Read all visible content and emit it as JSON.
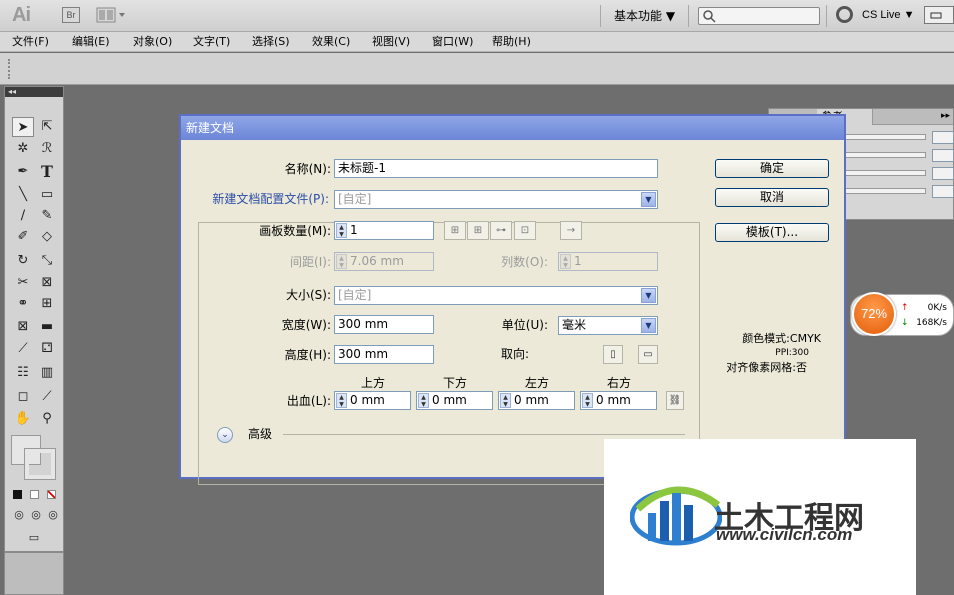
{
  "appbar": {
    "logo": "Ai",
    "br_label": "Br",
    "workspace": "基本功能 ▼",
    "cs_live": "CS Live ▼",
    "search_placeholder": ""
  },
  "menu": [
    "文件(F)",
    "编辑(E)",
    "对象(O)",
    "文字(T)",
    "选择(S)",
    "效果(C)",
    "视图(V)",
    "窗口(W)",
    "帮助(H)"
  ],
  "tools_header": "◂◂",
  "right_panel": {
    "tab": "参考"
  },
  "dialog": {
    "title": "新建文档",
    "name_label": "名称(N):",
    "name_value": "未标题-1",
    "profile_label": "新建文档配置文件(P):",
    "profile_value": "[自定]",
    "artboards_label": "画板数量(M):",
    "artboards_value": "1",
    "spacing_label": "间距(I):",
    "spacing_value": "7.06 mm",
    "columns_label": "列数(O):",
    "columns_value": "1",
    "size_label": "大小(S):",
    "size_value": "[自定]",
    "width_label": "宽度(W):",
    "width_value": "300 mm",
    "units_label": "单位(U):",
    "units_value": "毫米",
    "height_label": "高度(H):",
    "height_value": "300 mm",
    "orientation_label": "取向:",
    "bleed_label": "出血(L):",
    "bleed_headers": [
      "上方",
      "下方",
      "左方",
      "右方"
    ],
    "bleed_values": [
      "0 mm",
      "0 mm",
      "0 mm",
      "0 mm"
    ],
    "advanced_label": "高级",
    "ok_button": "确定",
    "cancel_button": "取消",
    "template_button": "模板(T)...",
    "info_color_mode": "颜色模式:CMYK",
    "info_ppi": "PPI:300",
    "info_pixel_grid": "对齐像素网格:否"
  },
  "speed_widget": {
    "percent": "72%",
    "up": "0K/s",
    "down": "168K/s"
  },
  "watermark": {
    "title": "土木工程网",
    "url": "www.civilcn.com"
  },
  "colors": {
    "dialog_bg": "#ece9d8",
    "title_bar": "#6c86d8",
    "badge": "#e35c08"
  }
}
